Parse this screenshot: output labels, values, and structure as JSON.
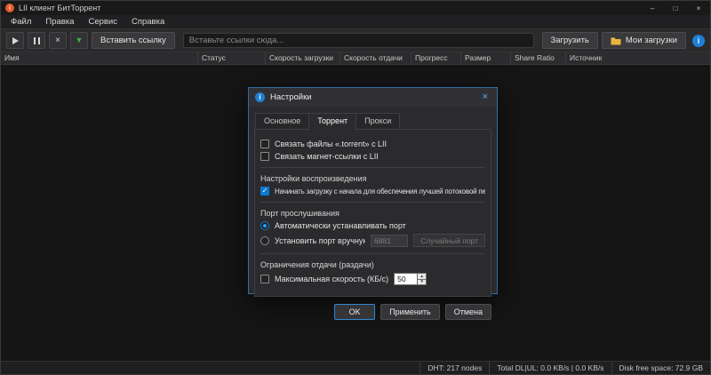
{
  "window": {
    "title": "LII клиент БитТоррент",
    "minimize": "–",
    "maximize": "□",
    "close": "×"
  },
  "menu": {
    "items": [
      {
        "label": "Файл"
      },
      {
        "label": "Правка"
      },
      {
        "label": "Сервис"
      },
      {
        "label": "Справка"
      }
    ]
  },
  "toolbar": {
    "paste_link": "Вставить ссылку",
    "url_placeholder": "Вставьте ссылки сюда...",
    "download": "Загрузить",
    "my_downloads": "Мои загрузки"
  },
  "table": {
    "columns": [
      {
        "label": "Имя"
      },
      {
        "label": "Статус"
      },
      {
        "label": "Скорость загрузки"
      },
      {
        "label": "Скорость отдачи"
      },
      {
        "label": "Прогресс"
      },
      {
        "label": "Размер"
      },
      {
        "label": "Share Ratio"
      },
      {
        "label": "Источник"
      }
    ]
  },
  "dialog": {
    "title": "Настройки",
    "close": "×",
    "tabs": [
      {
        "label": "Основное",
        "active": false
      },
      {
        "label": "Торрент",
        "active": true
      },
      {
        "label": "Прокси",
        "active": false
      }
    ],
    "associations": {
      "torrent_files": {
        "label": "Связать файлы «.torrent» с LII",
        "checked": false
      },
      "magnet_links": {
        "label": "Связать магнет-ссылки с LII",
        "checked": false
      }
    },
    "playback": {
      "section": "Настройки воспроизведения",
      "stream_first": {
        "label": "Начинать загрузку с начала для обеспечения лучшей потоковой передачи",
        "checked": true
      }
    },
    "port": {
      "section": "Порт прослушивания",
      "auto": {
        "label": "Автоматически устанавливать порт",
        "selected": true
      },
      "manual": {
        "label": "Установить порт вручную",
        "selected": false,
        "value": "6881"
      },
      "random_button": "Случайный порт"
    },
    "upload": {
      "section": "Ограничения отдачи (раздачи)",
      "max_speed": {
        "label": "Максимальная скорость (КБ/с)",
        "checked": false,
        "value": "50"
      }
    },
    "buttons": {
      "ok": "OK",
      "apply": "Применить",
      "cancel": "Отмена"
    }
  },
  "statusbar": {
    "dht": "DHT: 217 nodes",
    "total": "Total DL|UL: 0.0 KB/s | 0.0 KB/s",
    "disk": "Disk free space: 72.9 GB"
  },
  "colors": {
    "accent": "#0b79d0",
    "app_icon": "#e85a2a",
    "folder_icon": "#e8b33c"
  }
}
